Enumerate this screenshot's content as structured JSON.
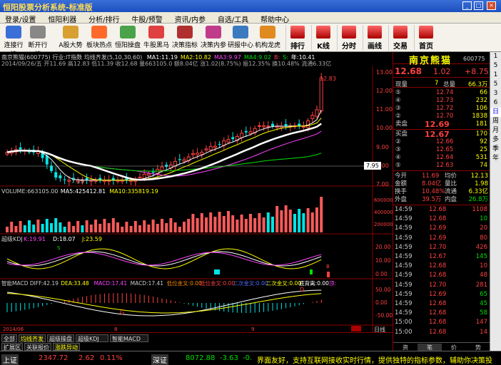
{
  "window": {
    "title": "恒阳股票分析系统-标准版",
    "min": "_",
    "max": "□",
    "close": "×"
  },
  "menu": [
    "登录/设置",
    "恒阳利器",
    "分析/排行",
    "牛股/预警",
    "资讯/内参",
    "自选/工具",
    "帮助中心"
  ],
  "toolbar_left": [
    {
      "label": "连接行情",
      "color": "#3a6fd8"
    },
    {
      "label": "断开行情",
      "color": "#888888"
    },
    {
      "label": "A股大势",
      "color": "#d8a030"
    },
    {
      "label": "板块热点",
      "color": "#ff6a2b"
    },
    {
      "label": "恒阳操盘",
      "color": "#4aa34a"
    },
    {
      "label": "牛股黑马",
      "color": "#e04040"
    },
    {
      "label": "决策指标",
      "color": "#b03030"
    },
    {
      "label": "决策内参",
      "color": "#c03c8a"
    },
    {
      "label": "研报中心",
      "color": "#3c7ac0"
    },
    {
      "label": "机构龙虎榜",
      "color": "#e08a20"
    }
  ],
  "toolbar_right": [
    "排行",
    "K线",
    "分时",
    "画线",
    "交易",
    "首页"
  ],
  "chart": {
    "header1": "南京熊猫(600775)  行业:IT指数  均线齐发(5,10,30,60)",
    "ma_labels": [
      {
        "text": "MA1:11.19",
        "color": "#ffffff"
      },
      {
        "text": "MA2:10.82",
        "color": "#ffff00"
      },
      {
        "text": "MA3:9.97",
        "color": "#ff44ff"
      },
      {
        "text": "MA4:9.02",
        "color": "#00e000"
      },
      {
        "text": "B:",
        "color": "#ff4040"
      },
      {
        "text": "S:",
        "color": "#00e000"
      },
      {
        "text": "年:10.41",
        "color": "#ffffff"
      }
    ],
    "header2": "2014/09/26/五 开11.69 高12.83 低11.39 收12.68 量663105.0 额8.04亿 涨1.02(8.75%) 振12.35% 换10.48% 流通6.33亿",
    "price_high_label": "12.83",
    "price_low_label": "7.13",
    "price_cursor_label": "7.95",
    "price_axis": [
      "13.00",
      "12.00",
      "11.00",
      "10.00",
      "9.00",
      "8.00",
      "7.00"
    ],
    "volume_header": [
      {
        "text": "VOLUME:663105.00",
        "color": "#cccccc"
      },
      {
        "text": "MA5:425412.81",
        "color": "#ffffff"
      },
      {
        "text": "MA10:335819.19",
        "color": "#ffff00"
      }
    ],
    "volume_axis": [
      "600000",
      "400000",
      "200000"
    ],
    "kdj_header": [
      {
        "text": "超级KDJ",
        "color": "#cccccc"
      },
      {
        "text": "K:19.91",
        "color": "#ff44ff"
      },
      {
        "text": "D:18.07",
        "color": "#ffffff"
      },
      {
        "text": "J:23.59",
        "color": "#ffff00"
      }
    ],
    "kdj_axis": [
      "20.00",
      "10.00",
      "0.00"
    ],
    "macd_header": [
      {
        "text": "智能MACD DIFF:42.19",
        "color": "#cccccc"
      },
      {
        "text": "DEA:33.48",
        "color": "#ffff00"
      },
      {
        "text": "MACD:17.41",
        "color": "#ff44ff"
      },
      {
        "text": "MACD:17.41",
        "color": "#cccccc"
      },
      {
        "text": "低位金叉:0.00",
        "color": "#ff8800"
      },
      {
        "text": "低位金叉:0.00",
        "color": "#ff4040"
      },
      {
        "text": "二次金叉:0.00",
        "color": "#4f6cff"
      },
      {
        "text": "二次金叉:0.00",
        "color": "#ffff00"
      },
      {
        "text": "底背离:0.00",
        "color": "#ffffff"
      },
      {
        "text": "顶:",
        "color": "#ff44ff"
      }
    ],
    "macd_axis": [
      "50.00",
      "0.00",
      "-50.00"
    ],
    "date_start": "2014/06",
    "date_marks": [
      "8",
      "9"
    ],
    "period": "日线",
    "signal_b": "B",
    "signal_s": "S",
    "signal_d": "D",
    "signal_g": "G"
  },
  "bottom_tabs_row1": [
    "全部",
    "均线齐发",
    "超级操盘",
    "超级KDJ",
    "智能MACD"
  ],
  "bottom_tabs_row2": [
    "扩展区",
    "关联报价",
    "涨跌异动"
  ],
  "quote": {
    "name": "南京熊猫",
    "code": "600775",
    "price": "12.68",
    "change": "1.02",
    "change_pct": "+8.75",
    "now_vol_label": "现量",
    "now_vol": "7",
    "total_label": "总量",
    "total": "66.3万",
    "sell": [
      {
        "lvl": "⑤",
        "price": "12.74",
        "vol": "66"
      },
      {
        "lvl": "④",
        "price": "12.73",
        "vol": "232"
      },
      {
        "lvl": "③",
        "price": "12.72",
        "vol": "106"
      },
      {
        "lvl": "②",
        "price": "12.70",
        "vol": "1838"
      },
      {
        "lvl": "卖盘",
        "price": "12.69",
        "vol": "181"
      }
    ],
    "buy": [
      {
        "lvl": "买盘",
        "price": "12.67",
        "vol": "170"
      },
      {
        "lvl": "②",
        "price": "12.66",
        "vol": "92"
      },
      {
        "lvl": "③",
        "price": "12.65",
        "vol": "25"
      },
      {
        "lvl": "④",
        "price": "12.64",
        "vol": "531"
      },
      {
        "lvl": "⑤",
        "price": "12.63",
        "vol": "74"
      }
    ],
    "stats": [
      {
        "l1": "今开",
        "v1": "11.69",
        "l2": "均价",
        "v2": "12.13"
      },
      {
        "l1": "金额",
        "v1": "8.04亿",
        "l2": "量比",
        "v2": "1.98"
      },
      {
        "l1": "换手",
        "v1": "10.48%",
        "l2": "流通",
        "v2": "6.33亿"
      },
      {
        "l1": "外盘",
        "v1": "39.5万",
        "l2": "内盘",
        "v2": "26.8万"
      }
    ],
    "ticks": [
      {
        "t": "14:59",
        "p": "12.68",
        "v": "1108",
        "c": "#ff4040"
      },
      {
        "t": "14:59",
        "p": "12.68",
        "v": "10",
        "c": "#00e000"
      },
      {
        "t": "14:59",
        "p": "12.69",
        "v": "20",
        "c": "#ff4040"
      },
      {
        "t": "14:59",
        "p": "12.69",
        "v": "80",
        "c": "#ff4040"
      },
      {
        "t": "14:59",
        "p": "12.70",
        "v": "426",
        "c": "#ff4040"
      },
      {
        "t": "14:59",
        "p": "12.67",
        "v": "145",
        "c": "#00e000"
      },
      {
        "t": "14:59",
        "p": "12.68",
        "v": "10",
        "c": "#ff4040"
      },
      {
        "t": "14:59",
        "p": "12.68",
        "v": "48",
        "c": "#ff4040"
      },
      {
        "t": "14:59",
        "p": "12.70",
        "v": "281",
        "c": "#ff4040"
      },
      {
        "t": "14:59",
        "p": "12.69",
        "v": "65",
        "c": "#00e000"
      },
      {
        "t": "14:59",
        "p": "12.68",
        "v": "45",
        "c": "#00e000"
      },
      {
        "t": "14:59",
        "p": "12.68",
        "v": "58",
        "c": "#00e000"
      },
      {
        "t": "15:00",
        "p": "12.68",
        "v": "147",
        "c": "#ff4040"
      },
      {
        "t": "15:00",
        "p": "12.68",
        "v": "14",
        "c": "#ff4040"
      }
    ],
    "bottom_tabs": [
      "资",
      "笔",
      "价",
      "势"
    ]
  },
  "side_tabs": [
    "1",
    "5",
    "1",
    "5",
    "3",
    "6",
    "日",
    "周",
    "月",
    "多",
    "季",
    "年"
  ],
  "status": {
    "idx1_name": "上证",
    "idx1_val": "2347.72",
    "idx1_chg": "2.62",
    "idx1_pct": "0.11%",
    "idx2_name": "深证",
    "idx2_val": "8072.88",
    "idx2_chg": "-3.63",
    "idx2_pct": "-0.",
    "ticker": "界面友好，支持互联网接收实时行情，提供独特的指标参数，辅助你决策投"
  }
}
